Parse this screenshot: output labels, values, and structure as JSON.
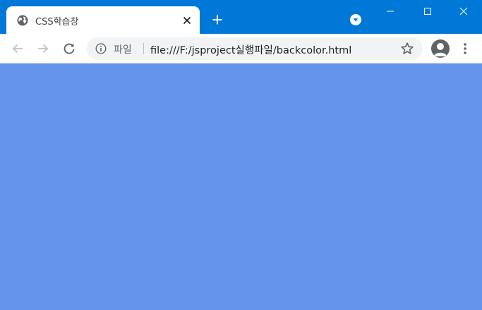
{
  "tab": {
    "title": "CSS학습창",
    "favicon": "globe-icon"
  },
  "window_controls": [
    "minimize-icon",
    "maximize-icon",
    "close-icon"
  ],
  "toolbar": {
    "scheme_label": "파일",
    "url": "file:///F:/jsproject실행파일/backcolor.html"
  },
  "page": {
    "background_color": "#6495ED"
  },
  "colors": {
    "titlebar": "#0078d7",
    "toolbar": "#ffffff",
    "omnibox": "#f1f3f4"
  }
}
